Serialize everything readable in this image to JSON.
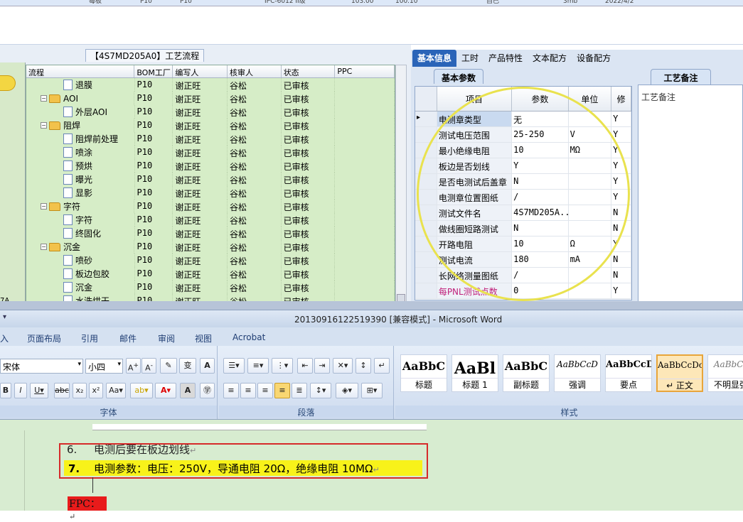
{
  "top_strip": {
    "items": [
      "每板",
      "P10",
      "P10",
      "IPC-6012 II级",
      "103.00",
      "100.10",
      "自己",
      "3mb",
      "2022/4/2"
    ]
  },
  "process": {
    "title": "【4S7MD205A0】工艺流程",
    "stub_label": "7A",
    "columns": [
      "流程",
      "BOM工厂",
      "编写人",
      "核审人",
      "状态",
      "PPC"
    ],
    "rows": [
      {
        "indent": 2,
        "kind": "item",
        "name": "退膜",
        "bom": "P10",
        "author": "谢正旺",
        "reviewer": "谷松",
        "status": "已审核"
      },
      {
        "indent": 1,
        "kind": "folder",
        "name": "AOI",
        "bom": "P10",
        "author": "谢正旺",
        "reviewer": "谷松",
        "status": "已审核"
      },
      {
        "indent": 2,
        "kind": "item",
        "name": "外层AOI",
        "bom": "P10",
        "author": "谢正旺",
        "reviewer": "谷松",
        "status": "已审核"
      },
      {
        "indent": 1,
        "kind": "folder",
        "name": "阻焊",
        "bom": "P10",
        "author": "谢正旺",
        "reviewer": "谷松",
        "status": "已审核"
      },
      {
        "indent": 2,
        "kind": "item",
        "name": "阻焊前处理",
        "bom": "P10",
        "author": "谢正旺",
        "reviewer": "谷松",
        "status": "已审核"
      },
      {
        "indent": 2,
        "kind": "item",
        "name": "喷涂",
        "bom": "P10",
        "author": "谢正旺",
        "reviewer": "谷松",
        "status": "已审核"
      },
      {
        "indent": 2,
        "kind": "item",
        "name": "预烘",
        "bom": "P10",
        "author": "谢正旺",
        "reviewer": "谷松",
        "status": "已审核"
      },
      {
        "indent": 2,
        "kind": "item",
        "name": "曝光",
        "bom": "P10",
        "author": "谢正旺",
        "reviewer": "谷松",
        "status": "已审核"
      },
      {
        "indent": 2,
        "kind": "item",
        "name": "显影",
        "bom": "P10",
        "author": "谢正旺",
        "reviewer": "谷松",
        "status": "已审核"
      },
      {
        "indent": 1,
        "kind": "folder",
        "name": "字符",
        "bom": "P10",
        "author": "谢正旺",
        "reviewer": "谷松",
        "status": "已审核"
      },
      {
        "indent": 2,
        "kind": "item",
        "name": "字符",
        "bom": "P10",
        "author": "谢正旺",
        "reviewer": "谷松",
        "status": "已审核"
      },
      {
        "indent": 2,
        "kind": "item",
        "name": "终固化",
        "bom": "P10",
        "author": "谢正旺",
        "reviewer": "谷松",
        "status": "已审核"
      },
      {
        "indent": 1,
        "kind": "folder",
        "name": "沉金",
        "bom": "P10",
        "author": "谢正旺",
        "reviewer": "谷松",
        "status": "已审核"
      },
      {
        "indent": 2,
        "kind": "item",
        "name": "喷砂",
        "bom": "P10",
        "author": "谢正旺",
        "reviewer": "谷松",
        "status": "已审核"
      },
      {
        "indent": 2,
        "kind": "item",
        "name": "板边包胶",
        "bom": "P10",
        "author": "谢正旺",
        "reviewer": "谷松",
        "status": "已审核"
      },
      {
        "indent": 2,
        "kind": "item",
        "name": "沉金",
        "bom": "P10",
        "author": "谢正旺",
        "reviewer": "谷松",
        "status": "已审核"
      },
      {
        "indent": 2,
        "kind": "item",
        "name": "水洗烘干",
        "bom": "P10",
        "author": "谢正旺",
        "reviewer": "谷松",
        "status": "已审核"
      }
    ]
  },
  "right_tabs": [
    "基本信息",
    "工时",
    "产品特性",
    "文本配方",
    "设备配方"
  ],
  "basic_params": {
    "tab": "基本参数",
    "columns": [
      "项目",
      "参数",
      "单位",
      "修"
    ],
    "rows": [
      {
        "item": "电测章类型",
        "value": "无",
        "unit": "",
        "flag": "Y",
        "current": true
      },
      {
        "item": "测试电压范围",
        "value": "25-250",
        "unit": "V",
        "flag": "Y"
      },
      {
        "item": "最小绝缘电阻",
        "value": "10",
        "unit": "MΩ",
        "flag": "Y"
      },
      {
        "item": "板边是否划线",
        "value": "Y",
        "unit": "",
        "flag": "Y"
      },
      {
        "item": "是否电测试后盖章",
        "value": "N",
        "unit": "",
        "flag": "Y"
      },
      {
        "item": "电测章位置图纸",
        "value": "/",
        "unit": "",
        "flag": "Y"
      },
      {
        "item": "测试文件名",
        "value": "4S7MD205A...",
        "unit": "",
        "flag": "N"
      },
      {
        "item": "做线圈短路测试",
        "value": "N",
        "unit": "",
        "flag": "N"
      },
      {
        "item": "开路电阻",
        "value": "10",
        "unit": "Ω",
        "flag": "Y"
      },
      {
        "item": "测试电流",
        "value": "180",
        "unit": "mA",
        "flag": "N"
      },
      {
        "item": "长网络测量图纸",
        "value": "/",
        "unit": "",
        "flag": "N"
      },
      {
        "item": "每PNL测试点数",
        "value": "0",
        "unit": "",
        "flag": "Y",
        "highlight_color": "#c0207a"
      }
    ]
  },
  "notes": {
    "tab": "工艺备注",
    "label": "工艺备注"
  },
  "word": {
    "title": "20130916122519390 [兼容模式] - Microsoft Word",
    "tabs": [
      "入",
      "页面布局",
      "引用",
      "邮件",
      "审阅",
      "视图",
      "Acrobat"
    ],
    "font_name": "宋体",
    "font_size": "小四",
    "groups": {
      "font": "字体",
      "paragraph": "段落",
      "styles": "样式"
    },
    "styles": [
      {
        "sample": "AaBbC",
        "name": "标题"
      },
      {
        "sample": "AaBl",
        "name": "标题 1"
      },
      {
        "sample": "AaBbC",
        "name": "副标题"
      },
      {
        "sample": "AaBbCcD",
        "name": "强调"
      },
      {
        "sample": "AaBbCcD",
        "name": "要点"
      },
      {
        "sample": "AaBbCcDc",
        "name": "↵ 正文",
        "selected": true
      },
      {
        "sample": "AaBbCc",
        "name": "不明显强"
      }
    ],
    "doc": {
      "line6_num": "6.",
      "line6_text": "电测后要在板边划线",
      "line7_num": "7.",
      "line7_text": "电测参数：电压：250V，导通电阻 20Ω，绝缘电阻 10MΩ",
      "fpc": "FPC：",
      "pilcrow": "↵"
    }
  },
  "colors": {
    "tab_active": "#2a64b8",
    "grid_bg": "#d6edc7",
    "highlight_yellow": "#f8f21a",
    "red_box": "#d62a2a",
    "circle": "#e9e24e"
  }
}
